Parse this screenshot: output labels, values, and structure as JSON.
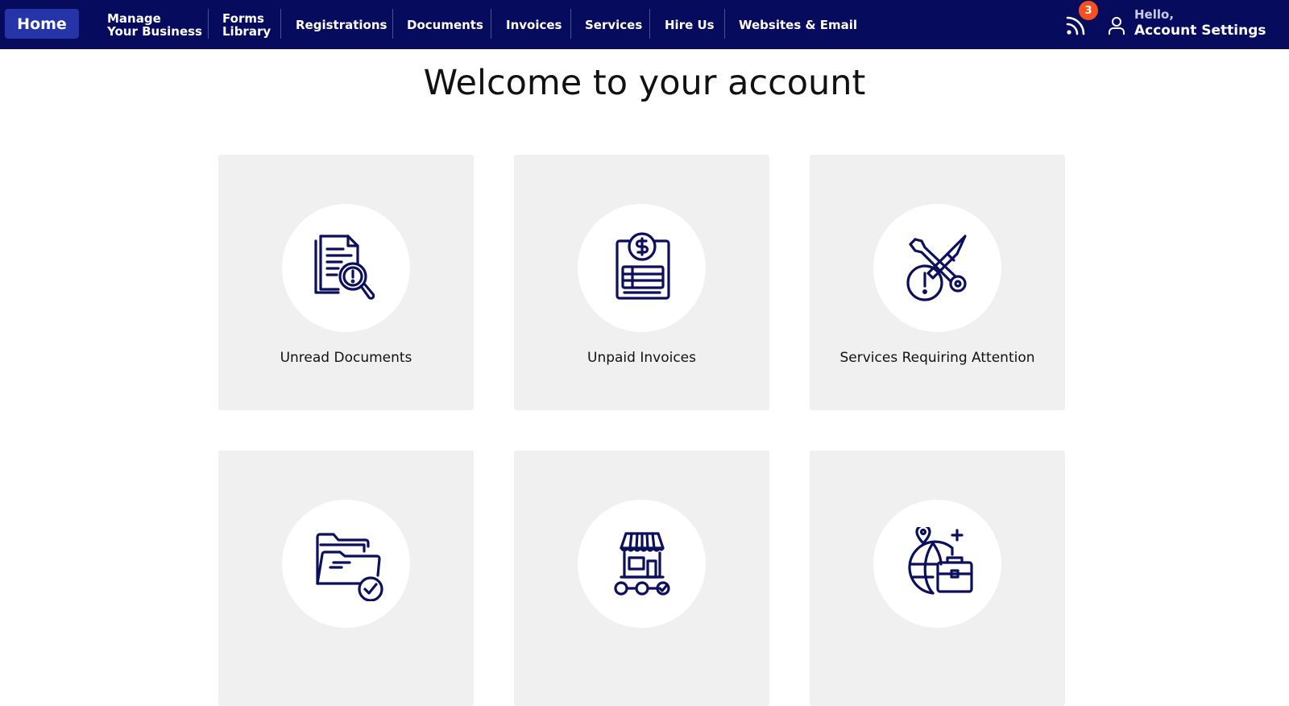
{
  "nav": {
    "home": "Home",
    "manage_line1": "Manage",
    "manage_line2": "Your Business",
    "forms_line1": "Forms",
    "forms_line2": "Library",
    "registrations": "Registrations",
    "documents": "Documents",
    "invoices": "Invoices",
    "services": "Services",
    "hire_us": "Hire Us",
    "websites": "Websites & Email",
    "notification_count": "3",
    "greeting": "Hello,",
    "account_settings": "Account Settings"
  },
  "main": {
    "title": "Welcome to your account",
    "cards": [
      {
        "label": "Unread Documents",
        "icon": "document-search-alert-icon"
      },
      {
        "label": "Unpaid Invoices",
        "icon": "invoice-dollar-icon"
      },
      {
        "label": "Services Requiring Attention",
        "icon": "tools-alert-icon"
      },
      {
        "label": "",
        "icon": "folder-check-icon"
      },
      {
        "label": "",
        "icon": "storefront-icon"
      },
      {
        "label": "",
        "icon": "globe-briefcase-icon"
      }
    ]
  },
  "colors": {
    "navbar": "#060b5e",
    "home_button": "#2535a8",
    "badge": "#f5501e",
    "card_bg": "#f0f0f0",
    "icon_stroke": "#0b0f5c"
  }
}
